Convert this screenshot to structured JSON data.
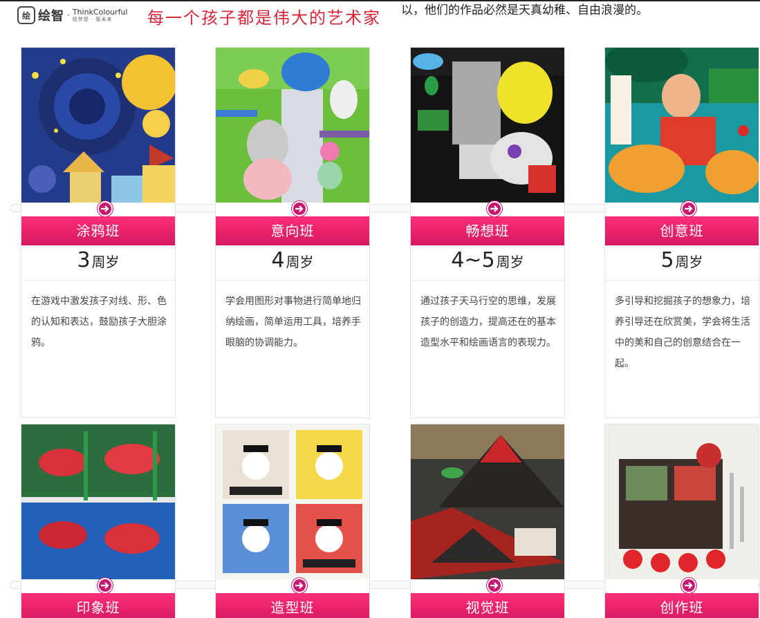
{
  "header": {
    "logo_mark": "绘",
    "logo_cn": "绘智",
    "logo_separator": "·",
    "logo_en": "ThinkColourful",
    "logo_sub": "绘梦想 · 智未来",
    "slogan": "每一个孩子都是伟大的艺术家",
    "intro": "以，他们的作品必然是天真幼稚、自由浪漫的。"
  },
  "colors": {
    "accent": "#d51860",
    "accent_light": "#ff2f78",
    "arrow": "#c81970",
    "slogan": "#d8263a"
  },
  "row1": [
    {
      "name": "涂鸦班",
      "age": "3",
      "unit": "周岁",
      "desc": "在游戏中激发孩子对线、形、色的认知和表达，鼓励孩子大胆涂鸦。"
    },
    {
      "name": "意向班",
      "age": "4",
      "unit": "周岁",
      "desc": "学会用图形对事物进行简单地归纳绘画，简单运用工具，培养手眼脑的协调能力。"
    },
    {
      "name": "畅想班",
      "age": "4~5",
      "unit": "周岁",
      "desc": "通过孩子天马行空的思维，发展孩子的创造力，提高还在的基本造型水平和绘画语言的表现力。"
    },
    {
      "name": "创意班",
      "age": "5",
      "unit": "周岁",
      "desc": "多引导和挖掘孩子的想象力，培养引导还在欣赏美，学会将生活中的美和自己的创意结合在一起。"
    }
  ],
  "row2": [
    {
      "name": "印象班"
    },
    {
      "name": "造型班"
    },
    {
      "name": "视觉班"
    },
    {
      "name": "创作班"
    }
  ],
  "icons": {
    "arrow": "arrow-right-circle-icon"
  }
}
